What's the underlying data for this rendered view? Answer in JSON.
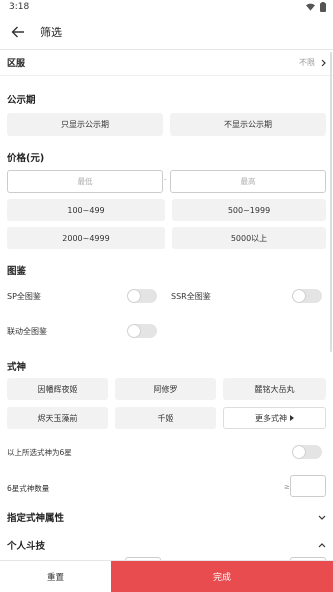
{
  "status": {
    "time": "3:18"
  },
  "header": {
    "title": "筛选"
  },
  "region": {
    "label": "区服",
    "value": "不限"
  },
  "notice": {
    "title": "公示期",
    "options": [
      "只显示公示期",
      "不显示公示期"
    ]
  },
  "price": {
    "title": "价格(元)",
    "min_placeholder": "最低",
    "max_placeholder": "最高",
    "separator": "-",
    "ranges": [
      "100~499",
      "500~1999",
      "2000~4999",
      "5000以上"
    ]
  },
  "tujian": {
    "title": "图鉴",
    "toggles": [
      {
        "label": "SP全图鉴",
        "on": false
      },
      {
        "label": "SSR全图鉴",
        "on": false
      },
      {
        "label": "联动全图鉴",
        "on": false
      }
    ]
  },
  "shishen": {
    "title": "式神",
    "items": [
      "因幡辉夜姬",
      "阿修罗",
      "麓铭大岳丸",
      "烬天玉藻前",
      "千姬"
    ],
    "more_label": "更多式神"
  },
  "six_star": {
    "toggle_label": "以上所选式神为6星",
    "toggle_on": false,
    "count_label": "6星式神数量",
    "count_prefix": "≥"
  },
  "attr": {
    "label": "指定式神属性"
  },
  "personal": {
    "label": "个人斗技"
  },
  "footer": {
    "reset": "重置",
    "done": "完成"
  },
  "colors": {
    "accent": "#e84c4f",
    "button_bg": "#f2f2f2"
  }
}
